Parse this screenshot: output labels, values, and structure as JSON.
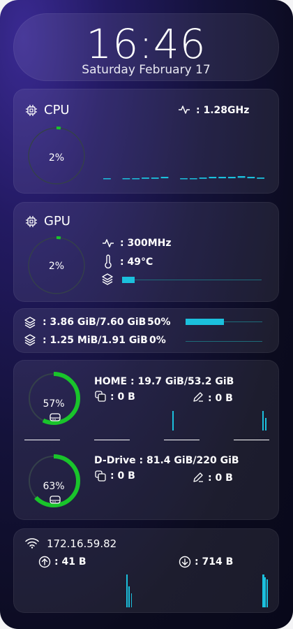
{
  "clock": {
    "time": "16:46",
    "date": "Saturday February 17"
  },
  "cpu": {
    "title": "CPU",
    "frequency": ": 1.28GHz",
    "usage": "2%",
    "usage_value": 2,
    "history": [
      0,
      0,
      0,
      0,
      1,
      1,
      2,
      2,
      0,
      0,
      1,
      2,
      2,
      2,
      3,
      2,
      1
    ]
  },
  "gpu": {
    "title": "GPU",
    "usage": "2%",
    "usage_value": 2,
    "frequency": ": 300MHz",
    "temperature": ": 49°C",
    "memory_fraction": 0.09
  },
  "memory": {
    "ram": {
      "text": ": 3.86 GiB/7.60 GiB",
      "percent": "50%",
      "fraction": 0.5
    },
    "swap": {
      "text": ": 1.25 MiB/1.91 GiB",
      "percent": "0%",
      "fraction": 0.0
    }
  },
  "disks": [
    {
      "name": "HOME : 19.7 GiB/53.2 GiB",
      "percent": "57%",
      "fraction": 0.57,
      "read": ": 0 B",
      "write": ": 0 B"
    },
    {
      "name": "D-Drive : 81.4 GiB/220 GiB",
      "percent": "63%",
      "fraction": 0.63,
      "read": ": 0 B",
      "write": ": 0 B"
    }
  ],
  "network": {
    "ip": "172.16.59.82",
    "upload": ": 41 B",
    "download": ": 714 B"
  },
  "colors": {
    "accent": "#1bc0dd",
    "ring_green": "#19c42b",
    "ring_track": "#34404a"
  },
  "icons": [
    "chip-icon",
    "pulse-icon",
    "thermometer-icon",
    "layers-icon",
    "drive-icon",
    "copy-icon",
    "pencil-icon",
    "wifi-icon",
    "upload-icon",
    "download-icon"
  ]
}
